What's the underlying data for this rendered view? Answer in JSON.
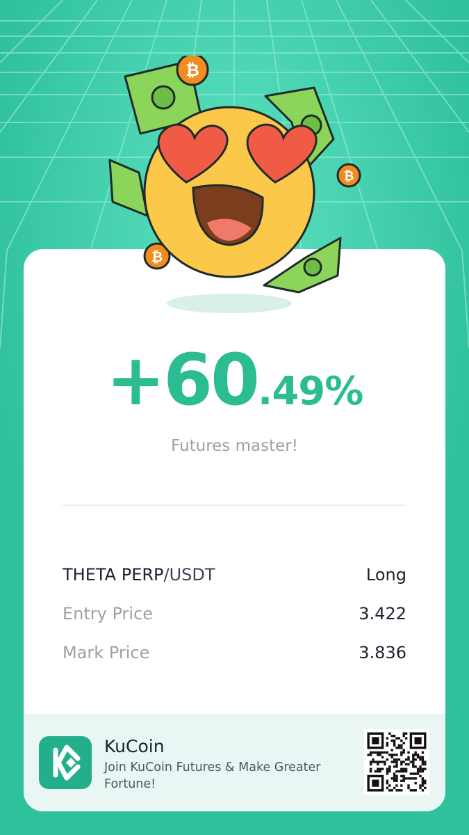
{
  "colors": {
    "background": "#2fc09c",
    "accent": "#2bbd91",
    "card": "#ffffff",
    "footer": "#eaf6f3"
  },
  "pnl": {
    "integer": "+60",
    "decimal": ".49%"
  },
  "subtitle": "Futures master!",
  "position": {
    "symbol_main": "THETA PERP",
    "symbol_quote": "/USDT",
    "side": "Long"
  },
  "rows": [
    {
      "label": "Entry Price",
      "value": "3.422"
    },
    {
      "label": "Mark Price",
      "value": "3.836"
    }
  ],
  "footer": {
    "brand": "KuCoin",
    "tagline": "Join KuCoin Futures & Make Greater Fortune!"
  },
  "icons": {
    "logo": "kucoin-logo-icon",
    "qr": "qr-code-icon",
    "illustration": "heart-eyes-emoji-icon"
  }
}
